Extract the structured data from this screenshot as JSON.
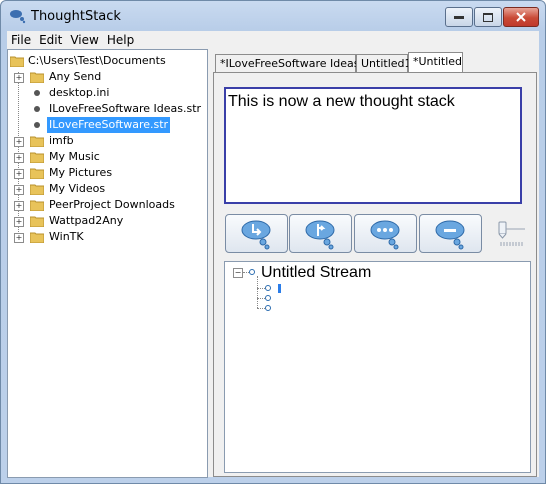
{
  "window": {
    "title": "ThoughtStack"
  },
  "menu": [
    "File",
    "Edit",
    "View",
    "Help"
  ],
  "file_tree": {
    "root": "C:\\Users\\Test\\Documents",
    "items": [
      {
        "label": "Any Send",
        "type": "folder"
      },
      {
        "label": "desktop.ini",
        "type": "file"
      },
      {
        "label": "ILoveFreeSoftware Ideas.str",
        "type": "file"
      },
      {
        "label": "ILoveFreeSoftware.str",
        "type": "file",
        "selected": true
      },
      {
        "label": "imfb",
        "type": "folder"
      },
      {
        "label": "My Music",
        "type": "folder"
      },
      {
        "label": "My Pictures",
        "type": "folder"
      },
      {
        "label": "My Videos",
        "type": "folder"
      },
      {
        "label": "PeerProject Downloads",
        "type": "folder"
      },
      {
        "label": "Wattpad2Any",
        "type": "folder"
      },
      {
        "label": "WinTK",
        "type": "folder"
      }
    ]
  },
  "tabs": [
    {
      "label": "*ILoveFreeSoftware Ideas"
    },
    {
      "label": "Untitled1"
    },
    {
      "label": "*Untitled",
      "active": true
    }
  ],
  "editor": {
    "text": "This is now a new thought stack"
  },
  "toolbar": [
    {
      "icon": "add-child-icon"
    },
    {
      "icon": "add-sibling-icon"
    },
    {
      "icon": "more-icon"
    },
    {
      "icon": "remove-icon"
    }
  ],
  "stream": {
    "title": "Untitled Stream"
  },
  "colors": {
    "accent": "#3399ff",
    "editor_border": "#3a3fa8",
    "close": "#c94a36"
  }
}
